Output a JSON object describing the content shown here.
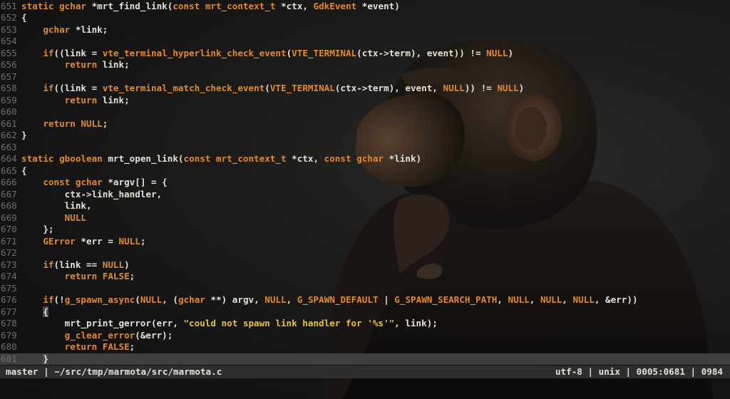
{
  "editor": {
    "lines": [
      {
        "n": "651",
        "tokens": [
          [
            "kw",
            "static "
          ],
          [
            "ty",
            "gchar"
          ],
          [
            "fn",
            " *mrt_find_link("
          ],
          [
            "kw",
            "const "
          ],
          [
            "ty",
            "mrt_context_t"
          ],
          [
            "fn",
            " *ctx, "
          ],
          [
            "ty",
            "GdkEvent"
          ],
          [
            "fn",
            " *event)"
          ]
        ]
      },
      {
        "n": "652",
        "tokens": [
          [
            "fn",
            "{"
          ]
        ]
      },
      {
        "n": "653",
        "tokens": [
          [
            "fn",
            "    "
          ],
          [
            "ty",
            "gchar"
          ],
          [
            "fn",
            " *link;"
          ]
        ]
      },
      {
        "n": "654",
        "tokens": []
      },
      {
        "n": "655",
        "tokens": [
          [
            "fn",
            "    "
          ],
          [
            "kw",
            "if"
          ],
          [
            "fn",
            "((link = "
          ],
          [
            "kw",
            "vte_terminal_hyperlink_check_event"
          ],
          [
            "fn",
            "("
          ],
          [
            "cst",
            "VTE_TERMINAL"
          ],
          [
            "fn",
            "(ctx->term), event)) != "
          ],
          [
            "cst",
            "NULL"
          ],
          [
            "fn",
            ")"
          ]
        ]
      },
      {
        "n": "656",
        "tokens": [
          [
            "fn",
            "        "
          ],
          [
            "kw",
            "return"
          ],
          [
            "fn",
            " link;"
          ]
        ]
      },
      {
        "n": "657",
        "tokens": []
      },
      {
        "n": "658",
        "tokens": [
          [
            "fn",
            "    "
          ],
          [
            "kw",
            "if"
          ],
          [
            "fn",
            "((link = "
          ],
          [
            "kw",
            "vte_terminal_match_check_event"
          ],
          [
            "fn",
            "("
          ],
          [
            "cst",
            "VTE_TERMINAL"
          ],
          [
            "fn",
            "(ctx->term), event, "
          ],
          [
            "cst",
            "NULL"
          ],
          [
            "fn",
            ")) != "
          ],
          [
            "cst",
            "NULL"
          ],
          [
            "fn",
            ")"
          ]
        ]
      },
      {
        "n": "659",
        "tokens": [
          [
            "fn",
            "        "
          ],
          [
            "kw",
            "return"
          ],
          [
            "fn",
            " link;"
          ]
        ]
      },
      {
        "n": "660",
        "tokens": []
      },
      {
        "n": "661",
        "tokens": [
          [
            "fn",
            "    "
          ],
          [
            "kw",
            "return "
          ],
          [
            "cst",
            "NULL"
          ],
          [
            "fn",
            ";"
          ]
        ]
      },
      {
        "n": "662",
        "tokens": [
          [
            "fn",
            "}"
          ]
        ]
      },
      {
        "n": "663",
        "tokens": []
      },
      {
        "n": "664",
        "tokens": [
          [
            "kw",
            "static "
          ],
          [
            "ty",
            "gboolean"
          ],
          [
            "fn",
            " mrt_open_link("
          ],
          [
            "kw",
            "const "
          ],
          [
            "ty",
            "mrt_context_t"
          ],
          [
            "fn",
            " *ctx, "
          ],
          [
            "kw",
            "const "
          ],
          [
            "ty",
            "gchar"
          ],
          [
            "fn",
            " *link)"
          ]
        ]
      },
      {
        "n": "665",
        "tokens": [
          [
            "fn",
            "{"
          ]
        ]
      },
      {
        "n": "666",
        "tokens": [
          [
            "fn",
            "    "
          ],
          [
            "kw",
            "const "
          ],
          [
            "ty",
            "gchar"
          ],
          [
            "fn",
            " *argv[] = {"
          ]
        ]
      },
      {
        "n": "667",
        "tokens": [
          [
            "fn",
            "        ctx->link_handler,"
          ]
        ]
      },
      {
        "n": "668",
        "tokens": [
          [
            "fn",
            "        link,"
          ]
        ]
      },
      {
        "n": "669",
        "tokens": [
          [
            "fn",
            "        "
          ],
          [
            "cst",
            "NULL"
          ]
        ]
      },
      {
        "n": "670",
        "tokens": [
          [
            "fn",
            "    };"
          ]
        ]
      },
      {
        "n": "671",
        "tokens": [
          [
            "fn",
            "    "
          ],
          [
            "ty",
            "GError"
          ],
          [
            "fn",
            " *err = "
          ],
          [
            "cst",
            "NULL"
          ],
          [
            "fn",
            ";"
          ]
        ]
      },
      {
        "n": "672",
        "tokens": []
      },
      {
        "n": "673",
        "tokens": [
          [
            "fn",
            "    "
          ],
          [
            "kw",
            "if"
          ],
          [
            "fn",
            "(link == "
          ],
          [
            "cst",
            "NULL"
          ],
          [
            "fn",
            ")"
          ]
        ]
      },
      {
        "n": "674",
        "tokens": [
          [
            "fn",
            "        "
          ],
          [
            "kw",
            "return "
          ],
          [
            "cst",
            "FALSE"
          ],
          [
            "fn",
            ";"
          ]
        ]
      },
      {
        "n": "675",
        "tokens": []
      },
      {
        "n": "676",
        "tokens": [
          [
            "fn",
            "    "
          ],
          [
            "kw",
            "if"
          ],
          [
            "fn",
            "(!"
          ],
          [
            "kw",
            "g_spawn_async"
          ],
          [
            "fn",
            "("
          ],
          [
            "cst",
            "NULL"
          ],
          [
            "fn",
            ", ("
          ],
          [
            "ty",
            "gchar"
          ],
          [
            "fn",
            " **) argv, "
          ],
          [
            "cst",
            "NULL"
          ],
          [
            "fn",
            ", "
          ],
          [
            "cst",
            "G_SPAWN_DEFAULT"
          ],
          [
            "fn",
            " | "
          ],
          [
            "cst",
            "G_SPAWN_SEARCH_PATH"
          ],
          [
            "fn",
            ", "
          ],
          [
            "cst",
            "NULL"
          ],
          [
            "fn",
            ", "
          ],
          [
            "cst",
            "NULL"
          ],
          [
            "fn",
            ", "
          ],
          [
            "cst",
            "NULL"
          ],
          [
            "fn",
            ", &err))"
          ]
        ]
      },
      {
        "n": "677",
        "tokens": [
          [
            "fn",
            "    "
          ],
          [
            "hl",
            "{"
          ]
        ]
      },
      {
        "n": "678",
        "tokens": [
          [
            "fn",
            "        mrt_print_gerror(err, "
          ],
          [
            "str",
            "\"could not spawn link handler for '%s'\""
          ],
          [
            "fn",
            ", link);"
          ]
        ]
      },
      {
        "n": "679",
        "tokens": [
          [
            "fn",
            "        "
          ],
          [
            "kw",
            "g_clear_error"
          ],
          [
            "fn",
            "(&err);"
          ]
        ]
      },
      {
        "n": "680",
        "tokens": [
          [
            "fn",
            "        "
          ],
          [
            "kw",
            "return "
          ],
          [
            "cst",
            "FALSE"
          ],
          [
            "fn",
            ";"
          ]
        ]
      },
      {
        "n": "681",
        "tokens": [
          [
            "fn",
            "    "
          ],
          [
            "hl",
            "}"
          ]
        ],
        "cursor": true
      }
    ]
  },
  "statusbar": {
    "left": "master | ~/src/tmp/marmota/src/marmota.c",
    "right": "utf-8 | unix | 0005:0681 | 0984"
  },
  "colors": {
    "keyword": "#e08a2c",
    "string": "#e6c33c",
    "text": "#e6e1d6",
    "line_number": "#6e6e6e",
    "statusbar_bg": "#2e2e2e"
  }
}
